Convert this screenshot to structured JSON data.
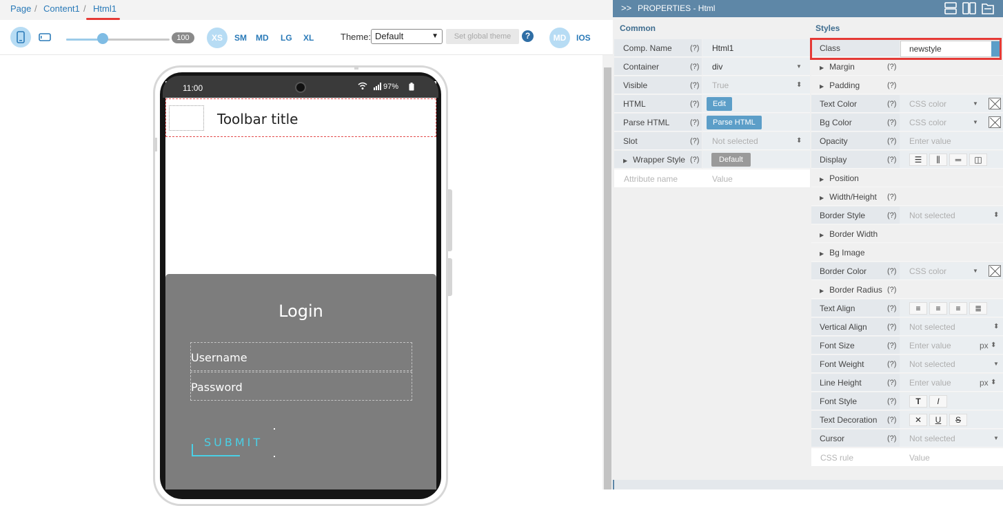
{
  "breadcrumb": {
    "items": [
      "Page",
      "Content1",
      "Html1"
    ],
    "separator": "/"
  },
  "toolbar": {
    "device_icons": [
      "phone-icon",
      "tablet-landscape-icon"
    ],
    "zoom_value": "100",
    "zoom_fraction": 0.35,
    "breakpoints": [
      "XS",
      "SM",
      "MD",
      "LG",
      "XL"
    ],
    "theme_label": "Theme:",
    "theme_value": "Default",
    "set_global_theme": "Set global theme",
    "help_glyph": "?",
    "platforms": [
      "MD",
      "IOS"
    ]
  },
  "phone": {
    "time": "11:00",
    "battery": "97%",
    "toolbar_title": "Toolbar title",
    "login": {
      "title": "Login",
      "username": "Username",
      "password": "Password",
      "submit": "SUBMIT"
    }
  },
  "properties": {
    "header": "PROPERTIES - Html",
    "chevron": ">>",
    "q": "(?)",
    "common": {
      "title": "Common",
      "rows": [
        {
          "label": "Comp. Name",
          "value": "Html1"
        },
        {
          "label": "Container",
          "value": "div"
        },
        {
          "label": "Visible",
          "value": "True"
        },
        {
          "label": "HTML",
          "button": "Edit"
        },
        {
          "label": "Parse HTML",
          "button": "Parse HTML"
        },
        {
          "label": "Slot",
          "value": "Not selected"
        },
        {
          "label": "Wrapper Style",
          "button": "Default"
        }
      ],
      "attribute_name_placeholder": "Attribute name",
      "attribute_value_placeholder": "Value"
    },
    "styles": {
      "title": "Styles",
      "class_label": "Class",
      "class_value": "newstyle",
      "rows": [
        {
          "label": "Margin"
        },
        {
          "label": "Padding"
        },
        {
          "label": "Text Color",
          "value": "CSS color"
        },
        {
          "label": "Bg Color",
          "value": "CSS color"
        },
        {
          "label": "Opacity",
          "value": "Enter value"
        },
        {
          "label": "Display"
        },
        {
          "label": "Position"
        },
        {
          "label": "Width/Height"
        },
        {
          "label": "Border Style",
          "value": "Not selected"
        },
        {
          "label": "Border Width"
        },
        {
          "label": "Bg Image"
        },
        {
          "label": "Border Color",
          "value": "CSS color"
        },
        {
          "label": "Border Radius"
        },
        {
          "label": "Text Align"
        },
        {
          "label": "Vertical Align",
          "value": "Not selected"
        },
        {
          "label": "Font Size",
          "value": "Enter value",
          "unit": "px"
        },
        {
          "label": "Font Weight",
          "value": "Not selected"
        },
        {
          "label": "Line Height",
          "value": "Enter value",
          "unit": "px"
        },
        {
          "label": "Font Style"
        },
        {
          "label": "Text Decoration"
        },
        {
          "label": "Cursor",
          "value": "Not selected"
        }
      ],
      "css_rule_placeholder": "CSS rule",
      "css_value_placeholder": "Value"
    }
  },
  "colors": {
    "accent": "#2a7ab8",
    "panel_header": "#5e87a7",
    "highlight": "#e53935",
    "login_bg": "#7d7d7d",
    "submit": "#4ad0e6"
  }
}
